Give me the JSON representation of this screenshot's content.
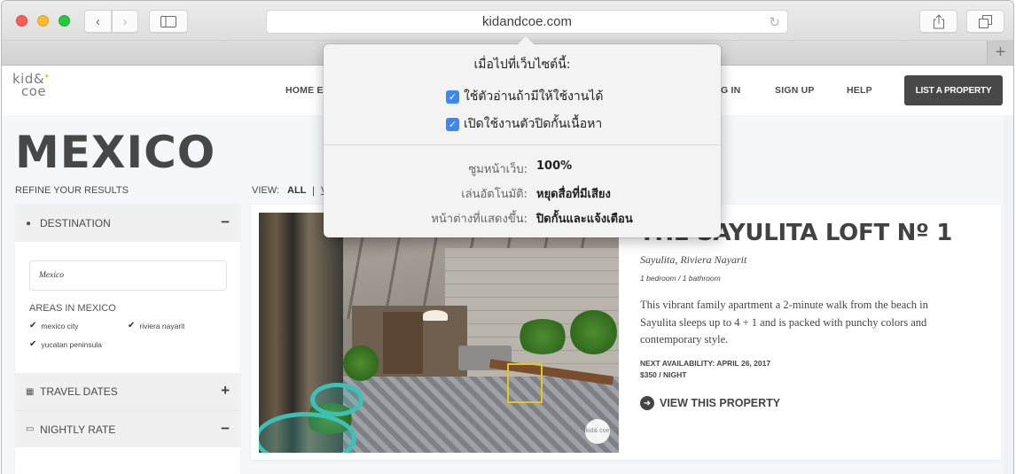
{
  "browser": {
    "url": "kidandcoe.com",
    "icons": {
      "close": "close-window",
      "minimize": "minimize-window",
      "zoom": "zoom-window",
      "back": "‹",
      "forward": "›",
      "sidebar": "▯",
      "reload": "↻",
      "share": "⇪",
      "tabs": "⧉",
      "new_tab": "+"
    }
  },
  "site": {
    "logo_line1": "kid&",
    "logo_line2": "coe",
    "nav": [
      "HOME EX",
      "G IN",
      "SIGN UP",
      "HELP"
    ],
    "list_property": "LIST A PROPERTY"
  },
  "page": {
    "title": "MEXICO",
    "refine_label": "REFINE YOUR RESULTS",
    "view_label": "VIEW:",
    "view_all": "ALL",
    "view_sep": "|",
    "view_next": "V"
  },
  "filters": {
    "destination": {
      "label": "DESTINATION",
      "toggle": "−",
      "icon": "●"
    },
    "destination_value": "Mexico",
    "areas_title": "AREAS IN MEXICO",
    "areas": [
      {
        "label": "mexico city",
        "checked": true
      },
      {
        "label": "riviera nayarit",
        "checked": true
      },
      {
        "label": "yucatan peninsula",
        "checked": true
      }
    ],
    "check_glyph": "✔",
    "travel_dates": {
      "label": "TRAVEL DATES",
      "toggle": "+",
      "icon": "▦"
    },
    "nightly_rate": {
      "label": "NIGHTLY RATE",
      "toggle": "−",
      "icon": "▭"
    }
  },
  "listing": {
    "title": "THE SAYULITA LOFT Nº 1",
    "location": "Sayulita, Riviera Nayarit",
    "rooms": "1 bedroom / 1 bathroom",
    "description": "This vibrant family apartment a 2-minute walk from the beach in Sayulita sleeps up to 4 + 1 and is packed with punchy colors and contemporary style.",
    "availability": "NEXT AVAILABILITY: APRIL 26, 2017",
    "price": "$350 / NIGHT",
    "cta": "VIEW THIS PROPERTY",
    "cta_icon": "➜",
    "watermark": "kid& coe"
  },
  "popover": {
    "title": "เมื่อไปที่เว็บไซต์นี้:",
    "checkboxes": [
      {
        "label": "ใช้ตัวอ่านถ้ามีให้ใช้งานได้",
        "checked": true
      },
      {
        "label": "เปิดใช้งานตัวปิดกั้นเนื้อหา",
        "checked": true
      }
    ],
    "check_glyph": "✓",
    "settings": [
      {
        "label": "ซูมหน้าเว็บ:",
        "value": "100%"
      },
      {
        "label": "เล่นอัตโนมัติ:",
        "value": "หยุดสื่อที่มีเสียง"
      },
      {
        "label": "หน้าต่างที่แสดงขึ้น:",
        "value": "ปิดกั้นและแจ้งเตือน"
      }
    ]
  }
}
